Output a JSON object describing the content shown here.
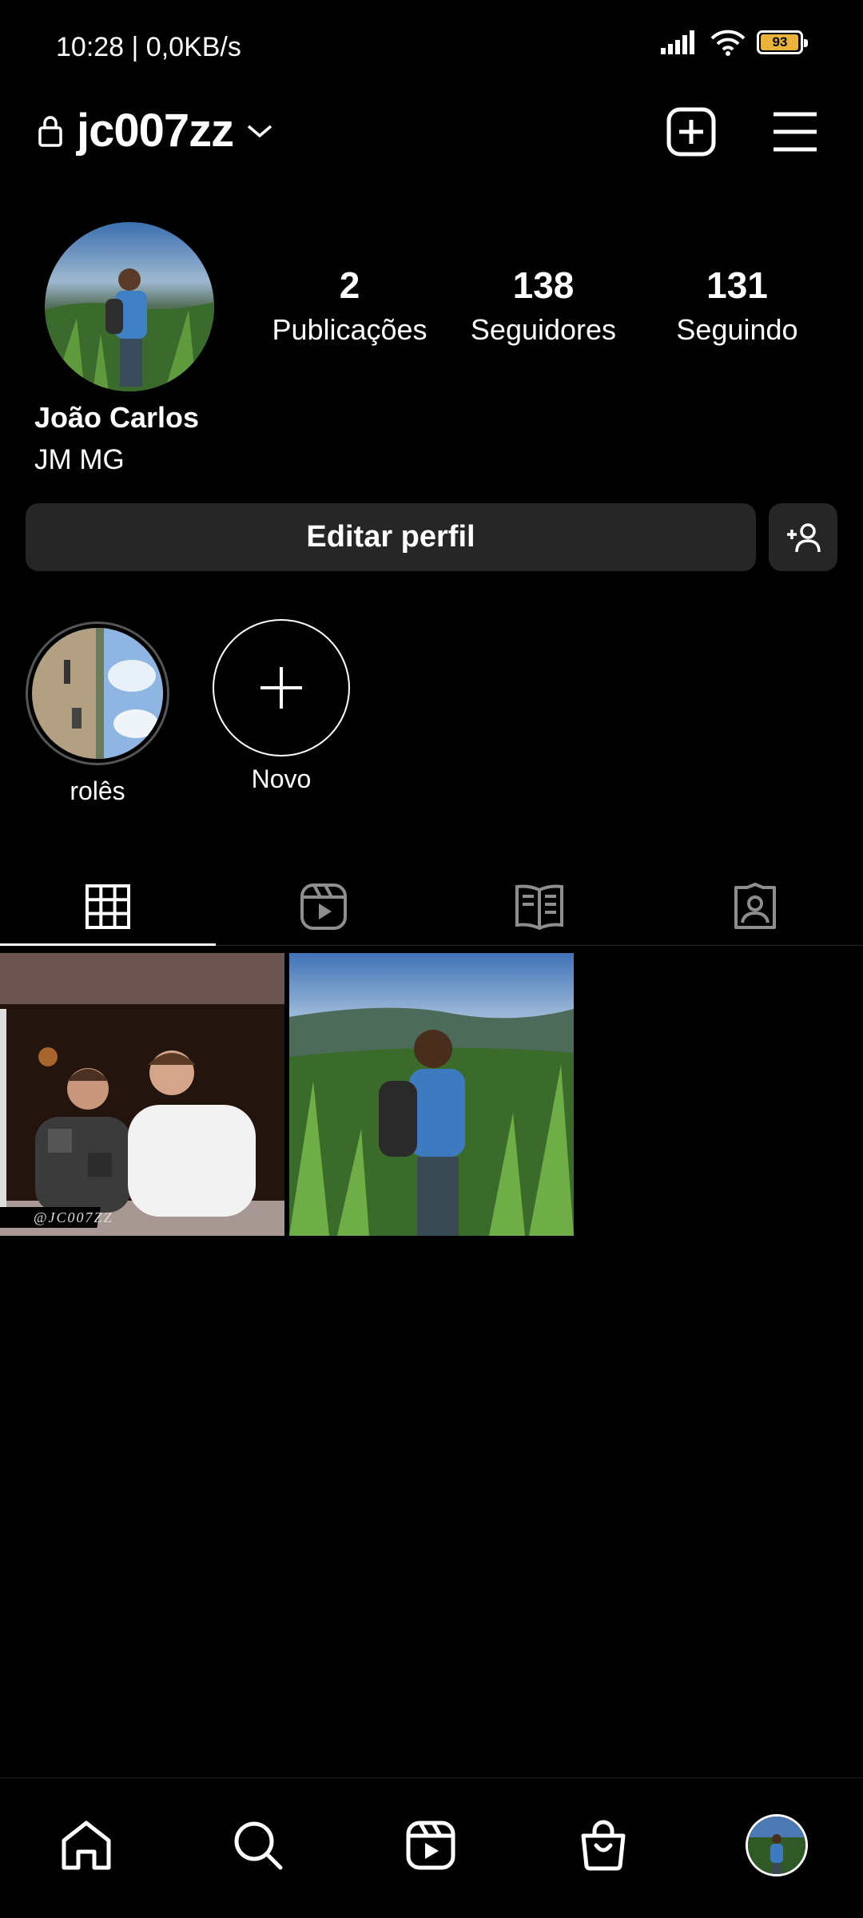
{
  "status_bar": {
    "time": "10:28 | 0,0KB/s",
    "battery_level": "93",
    "battery_color": "#e9b23a"
  },
  "header": {
    "username": "jc007zz",
    "icons": [
      "lock-icon",
      "chevron-down-icon",
      "new-post-icon",
      "menu-icon"
    ]
  },
  "profile": {
    "name": "João Carlos",
    "bio": "JM MG",
    "stats": [
      {
        "value": "2",
        "label": "Publicações"
      },
      {
        "value": "138",
        "label": "Seguidores"
      },
      {
        "value": "131",
        "label": "Seguindo"
      }
    ],
    "edit_label": "Editar perfil"
  },
  "highlights": [
    {
      "label": "rolês"
    },
    {
      "label": "Novo"
    }
  ],
  "tabs": [
    "grid-icon",
    "reels-icon",
    "guides-icon",
    "tagged-icon"
  ],
  "posts": [
    {
      "watermark": "@JC007ZZ"
    },
    {
      "watermark": ""
    }
  ],
  "bottom_nav": [
    "home-icon",
    "search-icon",
    "reels-icon",
    "shop-icon",
    "profile-avatar"
  ]
}
